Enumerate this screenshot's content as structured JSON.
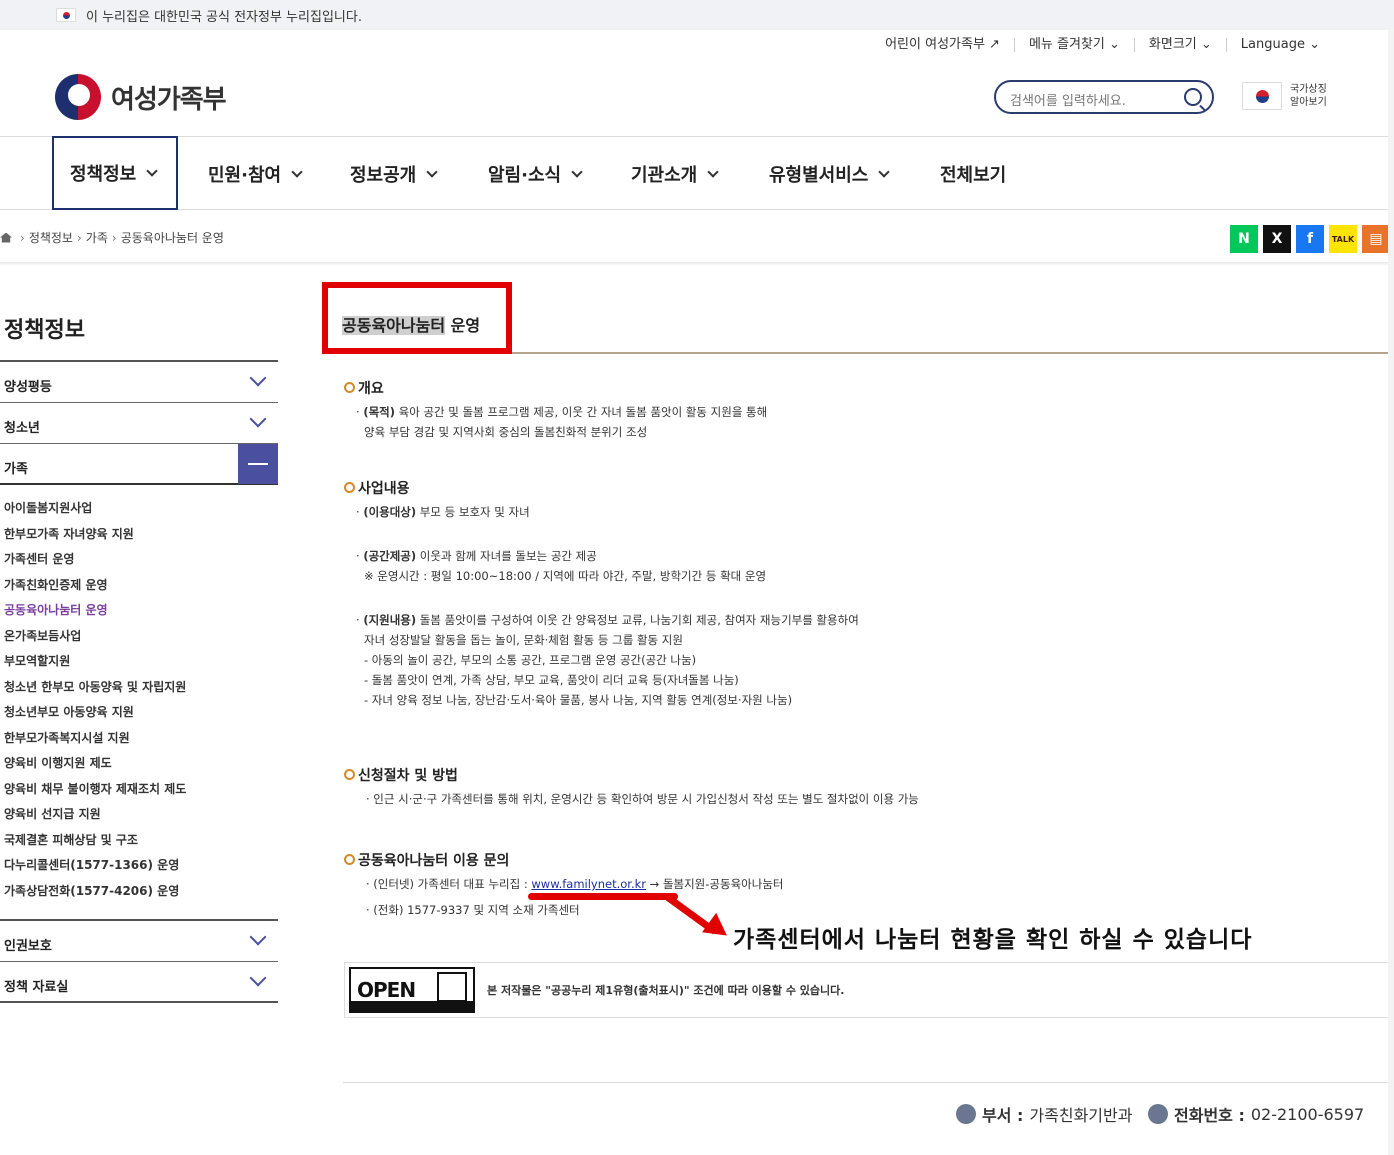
{
  "gov_banner": {
    "text": "이 누리집은 대한민국 공식 전자정부 누리집입니다."
  },
  "util_menu": {
    "kids": "어린이 여성가족부",
    "favorites": "메뉴 즐겨찾기",
    "screen_size": "화면크기",
    "language": "Language"
  },
  "logo": {
    "text": "여성가족부"
  },
  "search": {
    "placeholder": "검색어를 입력하세요."
  },
  "national_symbol": {
    "label": "국가상징 알아보기"
  },
  "gnb": [
    {
      "label": "정책정보",
      "active": true
    },
    {
      "label": "민원·참여"
    },
    {
      "label": "정보공개"
    },
    {
      "label": "알림·소식"
    },
    {
      "label": "기관소개"
    },
    {
      "label": "유형별서비스"
    },
    {
      "label": "전체보기"
    }
  ],
  "breadcrumb": [
    "정책정보",
    "가족",
    "공동육아나눔터 운영"
  ],
  "share": [
    {
      "label": "N",
      "name": "naver-blog",
      "color": "#03c75a"
    },
    {
      "label": "X",
      "name": "x-twitter",
      "color": "#111111"
    },
    {
      "label": "f",
      "name": "facebook",
      "color": "#1877f2"
    },
    {
      "label": "TALK",
      "name": "kakaotalk",
      "color": "#fee500"
    },
    {
      "label": "▤",
      "name": "print",
      "color": "#e8732a"
    }
  ],
  "sidebar": {
    "title": "정책정보",
    "items_top": [
      "양성평등",
      "청소년"
    ],
    "open_item": "가족",
    "sub_items": [
      "아이돌봄지원사업",
      "한부모가족 자녀양육 지원",
      "가족센터 운영",
      "가족친화인증제 운영",
      "공동육아나눔터 운영",
      "온가족보듬사업",
      "부모역할지원",
      "청소년 한부모 아동양육 및 자립지원",
      "청소년부모 아동양육 지원",
      "한부모가족복지시설 지원",
      "양육비 이행지원 제도",
      "양육비 채무 불이행자 제재조치 제도",
      "양육비 선지급 지원",
      "국제결혼 피해상담 및 구조",
      "다누리콜센터(1577-1366) 운영",
      "가족상담전화(1577-4206) 운영"
    ],
    "current_sub": "공동육아나눔터 운영",
    "items_bottom": [
      "인권보호",
      "정책 자료실"
    ]
  },
  "content": {
    "title_hl": "공동육아나눔터",
    "title_rest": " 운영",
    "overview": {
      "heading": "개요",
      "purpose_tag": "(목적)",
      "purpose_1": " 육아 공간 및 돌봄 프로그램 제공, 이웃 간 자녀 돌봄 품앗이 활동 지원을 통해",
      "purpose_2": "양육 부담 경감 및 지역사회 중심의 돌봄친화적 분위기 조성"
    },
    "business": {
      "heading": "사업내용",
      "target_tag": "(이용대상)",
      "target": " 부모 등 보호자 및 자녀",
      "space_tag": "(공간제공)",
      "space": " 이웃과 함께 자녀를 돌보는 공간 제공",
      "hours": "※ 운영시간 : 평일 10:00~18:00 / 지역에 따라 야간, 주말, 방학기간 등 확대 운영",
      "support_tag": "(지원내용)",
      "support_1": " 돌봄 품앗이를 구성하여 이웃 간 양육정보 교류, 나눔기회 제공, 참여자 재능기부를 활용하여",
      "support_2": "자녀 성장발달 활동을 돕는 놀이, 문화·체험 활동 등 그룹 활동 지원",
      "support_3": "- 아동의 놀이 공간, 부모의 소통 공간, 프로그램 운영 공간(공간 나눔)",
      "support_4": "- 돌봄 품앗이 연계, 가족 상담, 부모 교육, 품앗이 리더 교육 등(자녀돌봄 나눔)",
      "support_5": "- 자녀 양육 정보 나눔, 장난감·도서·육아 물품, 봉사 나눔, 지역 활동 연계(정보·자원 나눔)"
    },
    "apply": {
      "heading": "신청절차 및 방법",
      "text": "· 인근 시·군·구 가족센터를 통해 위치, 운영시간 등 확인하여 방문 시 가입신청서 작성 또는 별도 절차없이 이용 가능"
    },
    "inquiry": {
      "heading": "공동육아나눔터 이용 문의",
      "web_prefix": "· (인터넷) 가족센터 대표 누리집 : ",
      "web_link": "www.familynet.or.kr",
      "web_suffix": " → 돌봄지원-공동육아나눔터",
      "phone": "· (전화) 1577-9337 및 지역 소재 가족센터"
    },
    "license": {
      "logo_text": "OPEN",
      "text": "본 저작물은 \"공공누리 제1유형(출처표시)\" 조건에 따라 이용할 수 있습니다."
    },
    "annotation": "가족센터에서 나눔터 현황을 확인 하실 수 있습니다"
  },
  "footer": {
    "dept_label": "부서 :",
    "dept": "가족친화기반과",
    "phone_label": "전화번호 :",
    "phone": "02-2100-6597"
  }
}
